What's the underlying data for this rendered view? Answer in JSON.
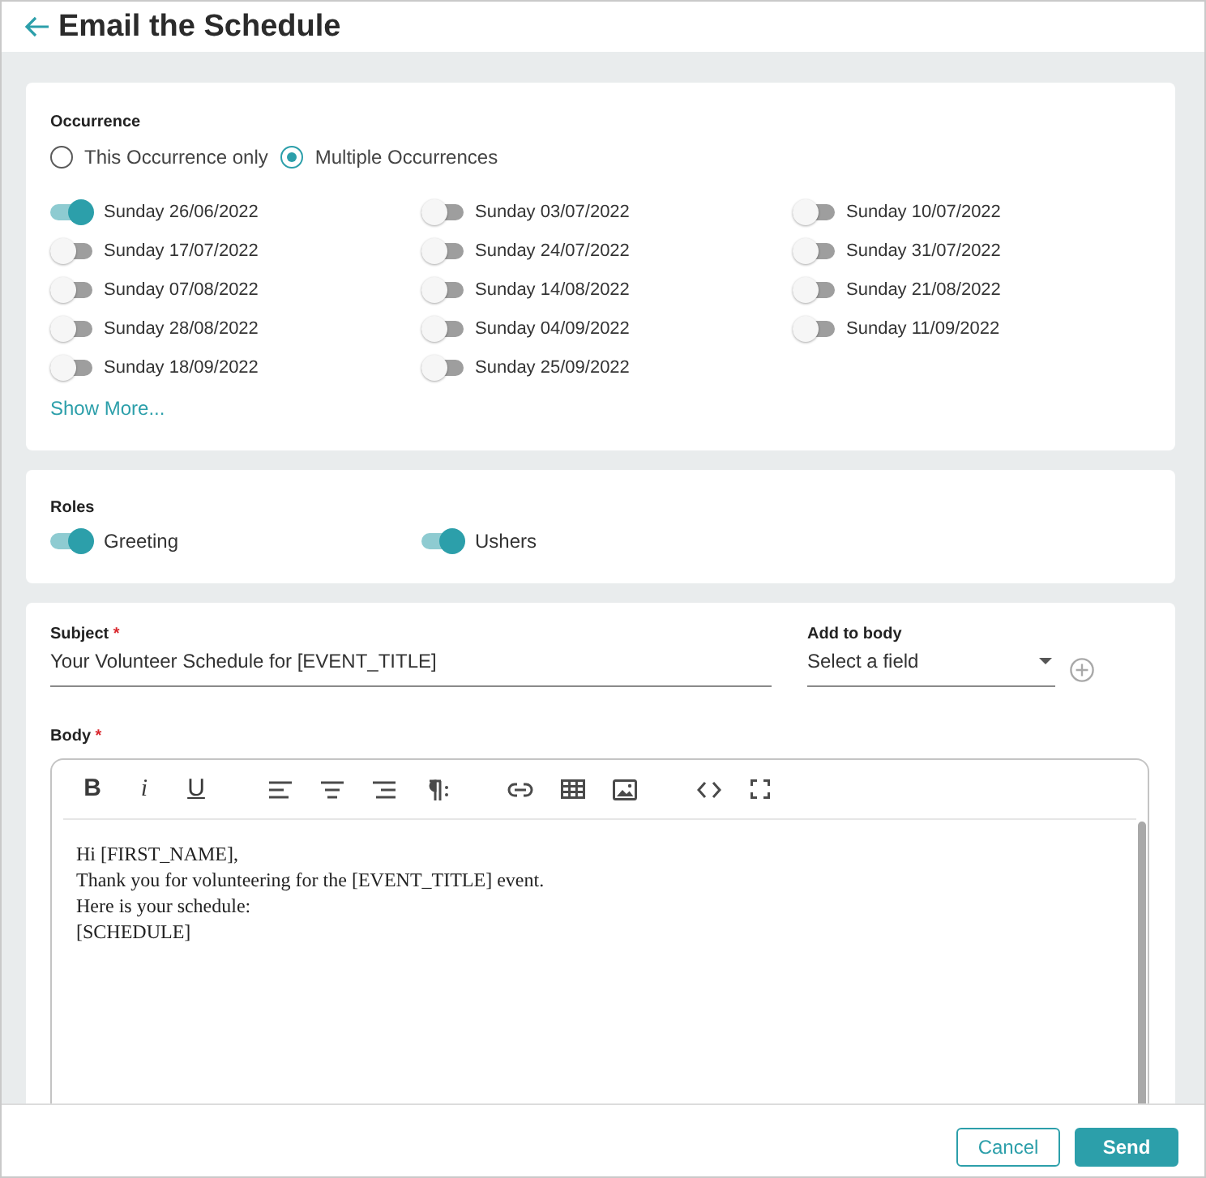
{
  "header": {
    "title": "Email the Schedule"
  },
  "occurrence": {
    "label": "Occurrence",
    "options": [
      {
        "label": "This Occurrence only",
        "selected": false
      },
      {
        "label": "Multiple Occurrences",
        "selected": true
      }
    ],
    "dates": [
      {
        "label": "Sunday 26/06/2022",
        "on": true
      },
      {
        "label": "Sunday 03/07/2022",
        "on": false
      },
      {
        "label": "Sunday 10/07/2022",
        "on": false
      },
      {
        "label": "Sunday 17/07/2022",
        "on": false
      },
      {
        "label": "Sunday 24/07/2022",
        "on": false
      },
      {
        "label": "Sunday 31/07/2022",
        "on": false
      },
      {
        "label": "Sunday 07/08/2022",
        "on": false
      },
      {
        "label": "Sunday 14/08/2022",
        "on": false
      },
      {
        "label": "Sunday 21/08/2022",
        "on": false
      },
      {
        "label": "Sunday 28/08/2022",
        "on": false
      },
      {
        "label": "Sunday 04/09/2022",
        "on": false
      },
      {
        "label": "Sunday 11/09/2022",
        "on": false
      },
      {
        "label": "Sunday 18/09/2022",
        "on": false
      },
      {
        "label": "Sunday 25/09/2022",
        "on": false
      }
    ],
    "show_more": "Show More..."
  },
  "roles": {
    "label": "Roles",
    "items": [
      {
        "label": "Greeting",
        "on": true
      },
      {
        "label": "Ushers",
        "on": true
      }
    ]
  },
  "email": {
    "subject": {
      "label": "Subject",
      "required_mark": "*",
      "value": "Your Volunteer Schedule for [EVENT_TITLE]"
    },
    "add_to_body": {
      "label": "Add to body",
      "placeholder": "Select a field"
    },
    "body": {
      "label": "Body",
      "required_mark": "*",
      "format_buttons": [
        {
          "kind": "bold",
          "text": "B"
        },
        {
          "kind": "italic",
          "text": "i"
        },
        {
          "kind": "underline",
          "text": "U"
        }
      ],
      "lines": [
        "Hi [FIRST_NAME],",
        "Thank you for volunteering for the [EVENT_TITLE] event.",
        "Here is your schedule:",
        "[SCHEDULE]"
      ]
    }
  },
  "footer": {
    "buttons": [
      {
        "kind": "cancel",
        "label": "Cancel"
      },
      {
        "kind": "submit",
        "label": "Send"
      }
    ]
  }
}
